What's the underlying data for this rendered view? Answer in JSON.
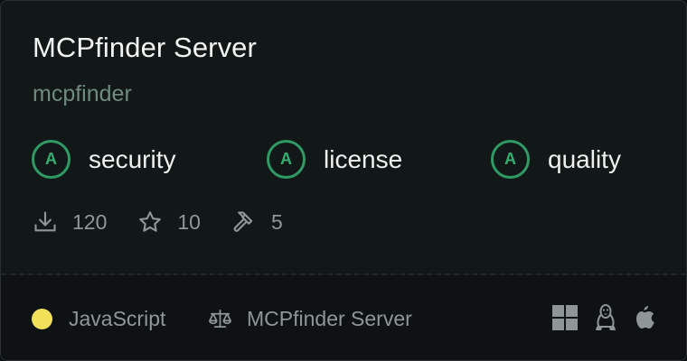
{
  "card": {
    "title": "MCPfinder Server",
    "subtitle": "mcpfinder"
  },
  "grades": [
    {
      "letter": "A",
      "label": "security"
    },
    {
      "letter": "A",
      "label": "license"
    },
    {
      "letter": "A",
      "label": "quality"
    }
  ],
  "stats": {
    "downloads": "120",
    "stars": "10",
    "tools": "5"
  },
  "footer": {
    "language": "JavaScript",
    "language_color": "#f1e05a",
    "license": "MCPfinder Server",
    "platforms": [
      "windows-icon",
      "linux-icon",
      "apple-icon"
    ]
  },
  "colors": {
    "grade_accent": "#2f9a64",
    "background": "#121718"
  }
}
